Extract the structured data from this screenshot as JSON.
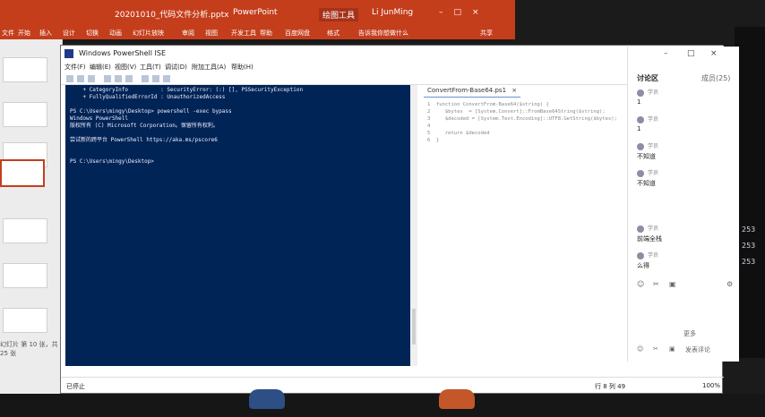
{
  "ppt": {
    "title": "20201010_代码文件分析.pptx",
    "app": "PowerPoint",
    "tool_tab": "绘图工具",
    "user": "Li JunMing",
    "tabs": [
      "文件",
      "开始",
      "插入",
      "设计",
      "切换",
      "动画",
      "幻灯片放映",
      "审阅",
      "视图",
      "开发工具",
      "帮助",
      "百度网盘",
      "格式",
      "告诉我你想做什么",
      "共享"
    ],
    "status_slide": "幻灯片 第 10 张，共 25 张"
  },
  "ise": {
    "title": "Windows PowerShell ISE",
    "menu": [
      "文件(F)",
      "编辑(E)",
      "视图(V)",
      "工具(T)",
      "调试(D)",
      "附加工具(A)",
      "帮助(H)"
    ],
    "console_lines": [
      "    + CategoryInfo          : SecurityError: (:) [], PSSecurityException",
      "    + FullyQualifiedErrorId : UnauthorizedAccess",
      "",
      "PS C:\\Users\\mingy\\Desktop> powershell -exec bypass",
      "Windows PowerShell",
      "版权所有 (C) Microsoft Corporation。保留所有权利。",
      "",
      "尝试新的跨平台 PowerShell https://aka.ms/pscore6",
      "",
      "",
      "PS C:\\Users\\mingy\\Desktop>"
    ],
    "editor_tab": "ConvertFrom-Base64.ps1",
    "editor_close": "×",
    "editor_lines": [
      "1  function ConvertFrom-Base64($string) {",
      "2     $bytes  = [System.Convert]::FromBase64String($string);",
      "3     $decoded = [System.Text.Encoding]::UTF8.GetString($bytes);",
      "4",
      "5     return $decoded",
      "6  }"
    ],
    "status_left": "已停止",
    "status_pos": "行 8 列 49",
    "status_zoom": "100%"
  },
  "discussion": {
    "tab_active": "讨论区",
    "tab_other": "成员(25)",
    "messages": [
      {
        "user": "学员",
        "text": "1"
      },
      {
        "user": "学员",
        "text": "1"
      },
      {
        "user": "学员",
        "text": "不知道"
      },
      {
        "user": "学员",
        "text": "不知道"
      },
      {
        "user": "学员",
        "text": "前端全栈"
      },
      {
        "user": "学员",
        "text": "么得"
      }
    ],
    "action_more": "更多",
    "input_hint": "发表评论"
  },
  "right_numbers": [
    "253",
    "253",
    "253"
  ]
}
